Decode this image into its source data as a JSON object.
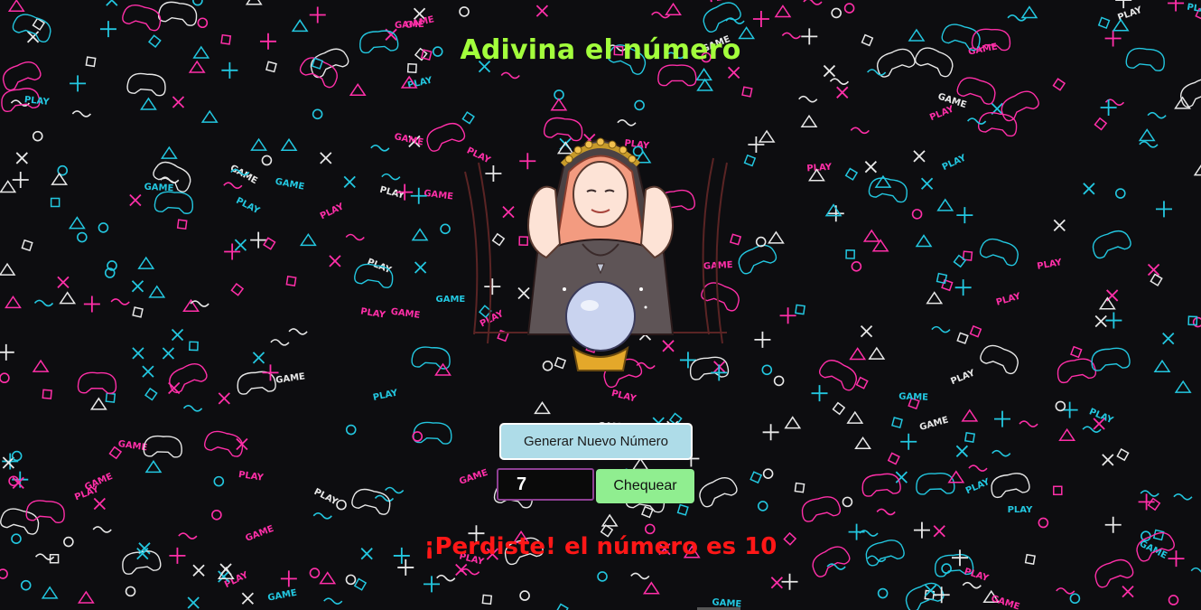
{
  "page": {
    "title": "Adivina el número",
    "background_pattern_words": [
      "PLAY",
      "GAME"
    ],
    "background_colors": {
      "base": "#0d0d10",
      "pink": "#ff2fa8",
      "cyan": "#23c7e0",
      "white": "#e8e8e8"
    }
  },
  "illustration": {
    "icon": "fortune-teller-crystal-ball-icon"
  },
  "controls": {
    "new_number_label": "Generar Nuevo Número",
    "guess_value": "7",
    "check_label": "Chequear"
  },
  "result": {
    "message": "¡Perdiste! el número es 10",
    "color": "#ff1717"
  },
  "colors": {
    "title": "#a3ff3c",
    "new_button": "#aedce8",
    "check_button": "#90ee90",
    "input_border": "#8e3f93"
  }
}
